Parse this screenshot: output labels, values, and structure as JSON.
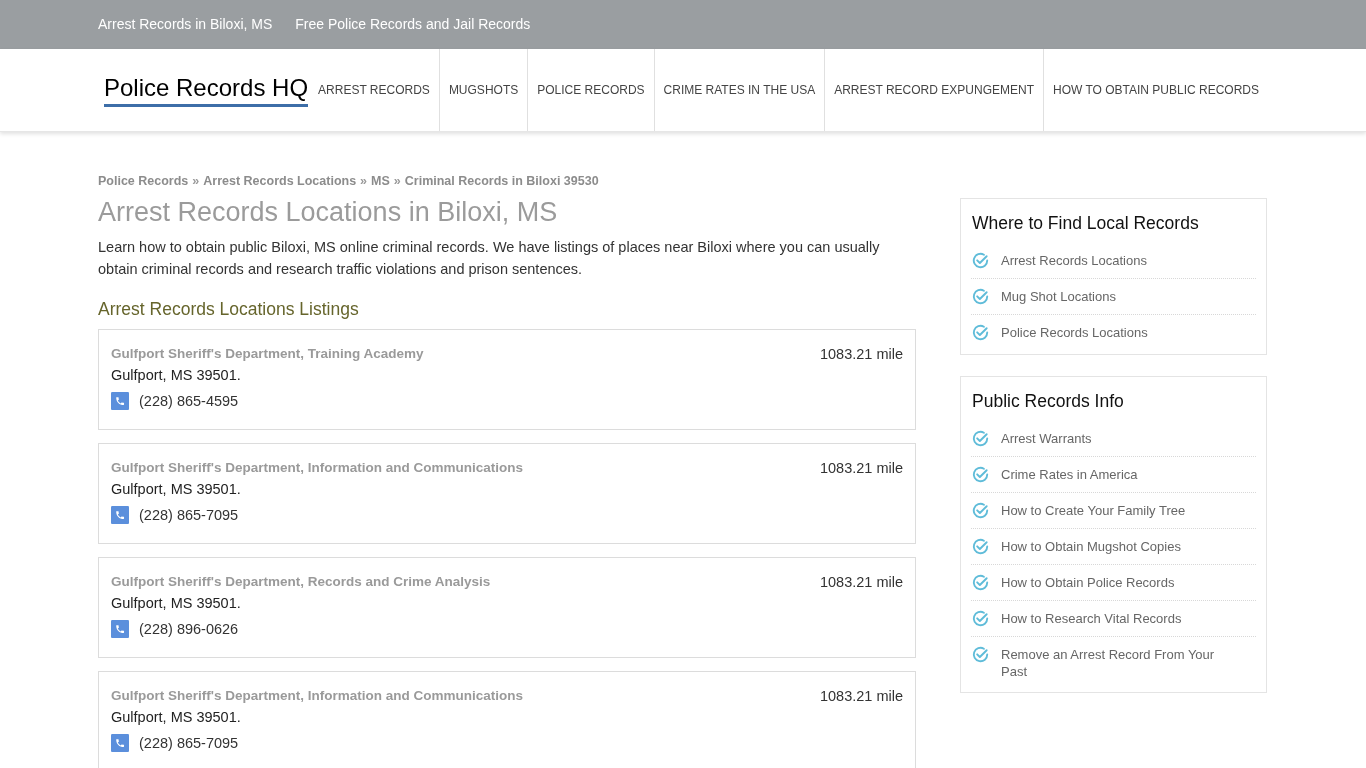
{
  "top_bar": {
    "links": [
      "Arrest Records in Biloxi, MS",
      "Free Police Records and Jail Records"
    ]
  },
  "header": {
    "logo": "Police Records HQ",
    "nav": [
      "ARREST RECORDS",
      "MUGSHOTS",
      "POLICE RECORDS",
      "CRIME RATES IN THE USA",
      "ARREST RECORD EXPUNGEMENT",
      "HOW TO OBTAIN PUBLIC RECORDS"
    ]
  },
  "breadcrumb": {
    "items": [
      "Police Records",
      "Arrest Records Locations",
      "MS",
      "Criminal Records in Biloxi 39530"
    ],
    "separators": [
      "»",
      "»",
      "»"
    ]
  },
  "page_title": "Arrest Records Locations in Biloxi, MS",
  "intro": "Learn how to obtain public Biloxi, MS online criminal records. We have listings of places near Biloxi where you can usually obtain criminal records and research traffic violations and prison sentences.",
  "listings_heading": "Arrest Records Locations Listings",
  "listings": [
    {
      "name": "Gulfport Sheriff's Department, Training Academy",
      "address": "Gulfport, MS 39501.",
      "phone": "(228) 865-4595",
      "distance": "1083.21 mile"
    },
    {
      "name": "Gulfport Sheriff's Department, Information and Communications",
      "address": "Gulfport, MS 39501.",
      "phone": "(228) 865-7095",
      "distance": "1083.21 mile"
    },
    {
      "name": "Gulfport Sheriff's Department, Records and Crime Analysis",
      "address": "Gulfport, MS 39501.",
      "phone": "(228) 896-0626",
      "distance": "1083.21 mile"
    },
    {
      "name": "Gulfport Sheriff's Department, Information and Communications",
      "address": "Gulfport, MS 39501.",
      "phone": "(228) 865-7095",
      "distance": "1083.21 mile"
    }
  ],
  "sidebar": [
    {
      "title": "Where to Find Local Records",
      "items": [
        "Arrest Records Locations",
        "Mug Shot Locations",
        "Police Records Locations"
      ]
    },
    {
      "title": "Public Records Info",
      "items": [
        "Arrest Warrants",
        "Crime Rates in America",
        "How to Create Your Family Tree",
        "How to Obtain Mugshot Copies",
        "How to Obtain Police Records",
        "How to Research Vital Records",
        "Remove an Arrest Record From Your Past"
      ]
    }
  ]
}
